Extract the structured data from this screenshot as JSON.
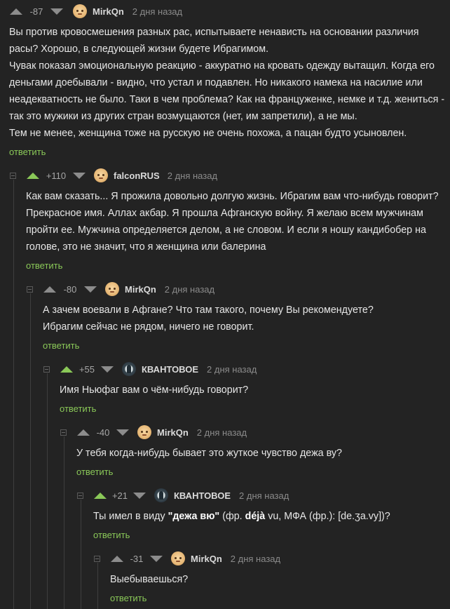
{
  "reply_label": "ответить",
  "colors": {
    "accent": "#8ac858",
    "background": "#232323"
  },
  "comments": [
    {
      "rating": "-87",
      "user": "MirkQn",
      "time": "2 дня назад",
      "avatar": "bald-face-avatar",
      "lines": [
        "Вы против кровосмешения разных рас, испытываете ненависть на основании различия",
        "расы? Хорошо, в следующей жизни будете Ибрагимом.",
        "Чувак показал эмоциональную реакцию - аккуратно на кровать одежду вытащил. Когда его",
        "деньгами доебывали - видно, что устал и подавлен. Но никакого намека на насилие или",
        "неадекватность не было. Таки в чем проблема? Как на француженке, немке и т.д. жениться -",
        "так это мужики из других стран возмущаются (нет, им запретили), а не мы.",
        "Тем не менее, женщина тоже на русскую не очень похожа, а пацан будто усыновлен."
      ]
    },
    {
      "rating": "+110",
      "user": "falconRUS",
      "time": "2 дня назад",
      "avatar": "face-avatar",
      "lines": [
        "Как вам сказать... Я прожила довольно долгую жизнь. Ибрагим вам что-нибудь говорит?",
        "Прекрасное имя. Аллах акбар. Я прошла Афганскую войну. Я желаю всем мужчинам",
        "пройти ее. Мужчина определяется делом, а не словом. И если я ношу кандибобер на",
        "голове, это не значит, что я женщина или балерина"
      ]
    },
    {
      "rating": "-80",
      "user": "MirkQn",
      "time": "2 дня назад",
      "avatar": "bald-face-avatar",
      "lines": [
        "А зачем воевали в Афгане? Что там такого, почему Вы рекомендуете?",
        "Ибрагим сейчас не рядом, ничего не говорит."
      ]
    },
    {
      "rating": "+55",
      "user": "КВАНТОВОЕ",
      "time": "2 дня назад",
      "avatar": "figure-avatar",
      "lines": [
        "Имя Ньюфаг вам о чём-нибудь говорит?"
      ]
    },
    {
      "rating": "-40",
      "user": "MirkQn",
      "time": "2 дня назад",
      "avatar": "bald-face-avatar",
      "lines": [
        "У тебя когда-нибудь бывает это жуткое чувство дежа ву?"
      ]
    },
    {
      "rating": "+21",
      "user": "КВАНТОВОЕ",
      "time": "2 дня назад",
      "avatar": "figure-avatar",
      "rich": {
        "pre": "Ты имел в виду ",
        "bold1": "\"дежа вю\"",
        "mid": " (фр. ",
        "bold2": "déjà",
        "post": " vu, МФА (фр.): [de.ʒa.vy])?"
      }
    },
    {
      "rating": "-31",
      "user": "MirkQn",
      "time": "2 дня назад",
      "avatar": "bald-face-avatar",
      "lines": [
        "Выебываешься?"
      ]
    }
  ]
}
